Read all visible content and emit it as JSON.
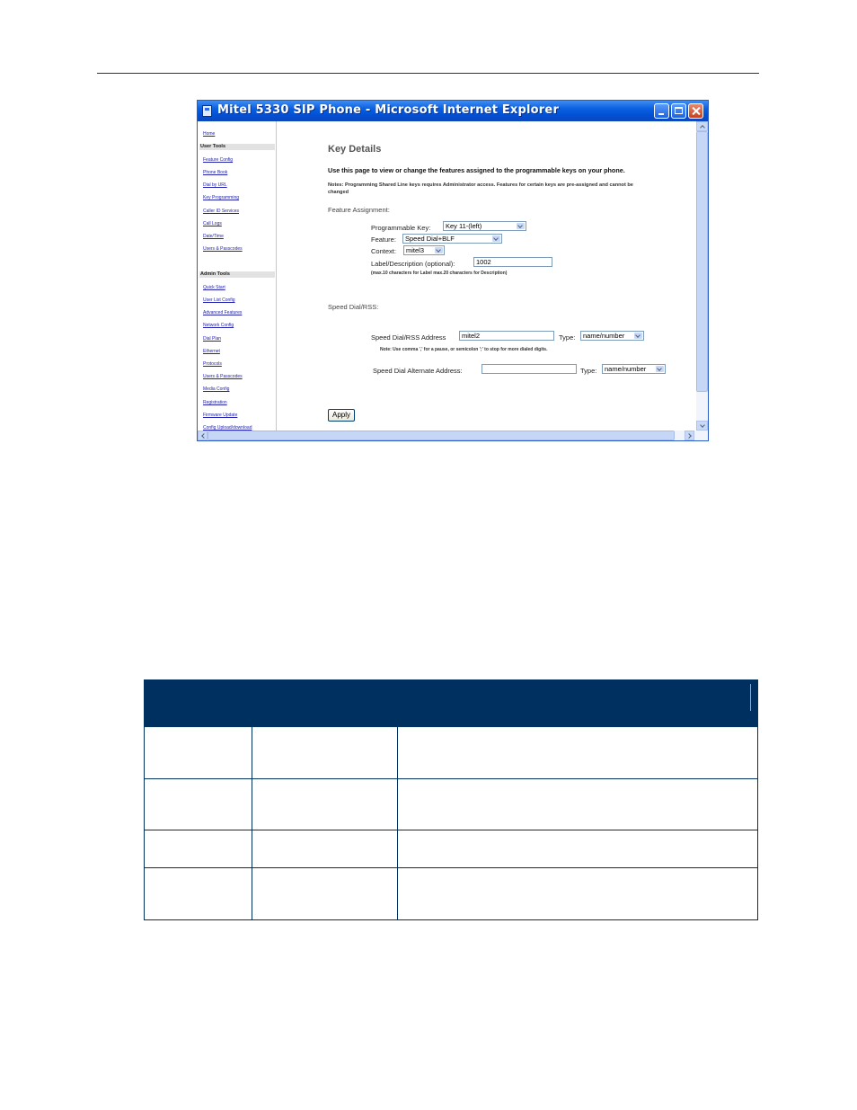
{
  "window": {
    "title": "Mitel 5330 SIP Phone - Microsoft Internet Explorer"
  },
  "sidebar": {
    "home": "Home",
    "user_tools_heading": "User Tools",
    "user_tools": [
      "Feature Config",
      "Phone Book",
      "Dial by URL",
      "Key Programming",
      "Caller ID Services",
      "Call Logs",
      "Date/Time",
      "Users & Passcodes"
    ],
    "admin_tools_heading": "Admin Tools",
    "admin_tools": [
      "Quick Start",
      "User List Config",
      "Advanced Features",
      "Network Config",
      "Dial Plan",
      "Ethernet",
      "Protocols",
      "Users & Passcodes",
      "Media Config",
      "Registration",
      "Firmware Update",
      "Config Upload/download"
    ]
  },
  "main": {
    "title": "Key Details",
    "intro": "Use this page to view or change the features assigned to the programmable keys on your phone.",
    "notes_line1": "Notes: Programming Shared Line keys requires Administrator access. Features for certain keys are pre-assigned and cannot be",
    "notes_line2": "changed",
    "feature_assignment_heading": "Feature Assignment:",
    "programmable_key_label": "Programmable Key:",
    "programmable_key_value": "Key 11-(left)",
    "feature_label": "Feature:",
    "feature_value": "Speed Dial+BLF",
    "context_label": "Context:",
    "context_value": "mitel3",
    "label_desc_label": "Label/Description (optional):",
    "label_desc_value": "1002",
    "label_desc_note": "(max.10 characters for Label max.20 characters for Description)",
    "speed_dial_heading": "Speed Dial/RSS:",
    "sd_address_label": "Speed Dial/RSS Address",
    "sd_address_value": "mitel2",
    "type_label": "Type:",
    "type_value": "name/number",
    "sd_note": "Note: Use comma ',' for a pause, or semicolon ';' to stop for more dialed digits.",
    "alt_address_label": "Speed Dial Alternate Address:",
    "alt_address_value": "",
    "alt_type_label": "Type:",
    "alt_type_value": "name/number",
    "apply_label": "Apply"
  },
  "table": {
    "row_heights": [],
    "colors": {
      "header_bg": "#00305f",
      "border": "#00305f"
    }
  }
}
